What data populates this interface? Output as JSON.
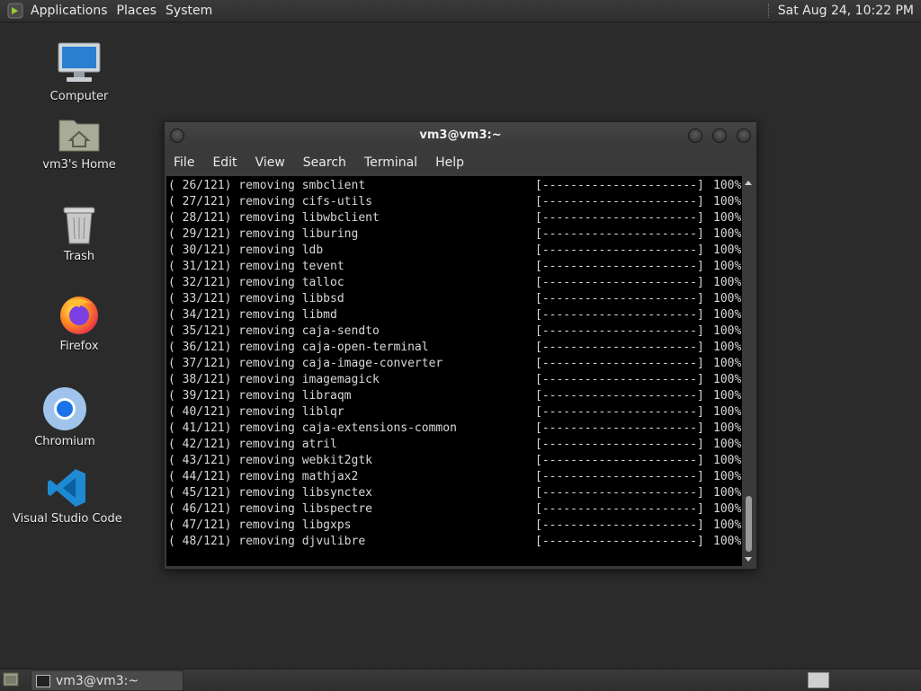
{
  "top_panel": {
    "menus": [
      "Applications",
      "Places",
      "System"
    ],
    "clock": "Sat Aug 24, 10:22 PM"
  },
  "desktop_icons": [
    {
      "label": "Computer",
      "icon": "computer-icon"
    },
    {
      "label": "vm3's Home",
      "icon": "home-folder-icon"
    },
    {
      "label": "Trash",
      "icon": "trash-icon"
    },
    {
      "label": "Firefox",
      "icon": "firefox-icon"
    },
    {
      "label": "Chromium",
      "icon": "chromium-icon"
    },
    {
      "label": "Visual Studio Code",
      "icon": "vscode-icon"
    }
  ],
  "terminal": {
    "title": "vm3@vm3:~",
    "menu": [
      "File",
      "Edit",
      "View",
      "Search",
      "Terminal",
      "Help"
    ],
    "progress_bar": "[----------------------]",
    "lines": [
      {
        "step": "( 26/121) removing smbclient",
        "percent": "100%"
      },
      {
        "step": "( 27/121) removing cifs-utils",
        "percent": "100%"
      },
      {
        "step": "( 28/121) removing libwbclient",
        "percent": "100%"
      },
      {
        "step": "( 29/121) removing liburing",
        "percent": "100%"
      },
      {
        "step": "( 30/121) removing ldb",
        "percent": "100%"
      },
      {
        "step": "( 31/121) removing tevent",
        "percent": "100%"
      },
      {
        "step": "( 32/121) removing talloc",
        "percent": "100%"
      },
      {
        "step": "( 33/121) removing libbsd",
        "percent": "100%"
      },
      {
        "step": "( 34/121) removing libmd",
        "percent": "100%"
      },
      {
        "step": "( 35/121) removing caja-sendto",
        "percent": "100%"
      },
      {
        "step": "( 36/121) removing caja-open-terminal",
        "percent": "100%"
      },
      {
        "step": "( 37/121) removing caja-image-converter",
        "percent": "100%"
      },
      {
        "step": "( 38/121) removing imagemagick",
        "percent": "100%"
      },
      {
        "step": "( 39/121) removing libraqm",
        "percent": "100%"
      },
      {
        "step": "( 40/121) removing liblqr",
        "percent": "100%"
      },
      {
        "step": "( 41/121) removing caja-extensions-common",
        "percent": "100%"
      },
      {
        "step": "( 42/121) removing atril",
        "percent": "100%"
      },
      {
        "step": "( 43/121) removing webkit2gtk",
        "percent": "100%"
      },
      {
        "step": "( 44/121) removing mathjax2",
        "percent": "100%"
      },
      {
        "step": "( 45/121) removing libsynctex",
        "percent": "100%"
      },
      {
        "step": "( 46/121) removing libspectre",
        "percent": "100%"
      },
      {
        "step": "( 47/121) removing libgxps",
        "percent": "100%"
      },
      {
        "step": "( 48/121) removing djvulibre",
        "percent": "100%"
      }
    ]
  },
  "taskbar": {
    "task_label": "vm3@vm3:~"
  },
  "colors": {
    "desktop": "#2b2b2b",
    "terminal_bg": "#000000",
    "terminal_fg": "#d8d8d8",
    "panel": "#333333"
  }
}
